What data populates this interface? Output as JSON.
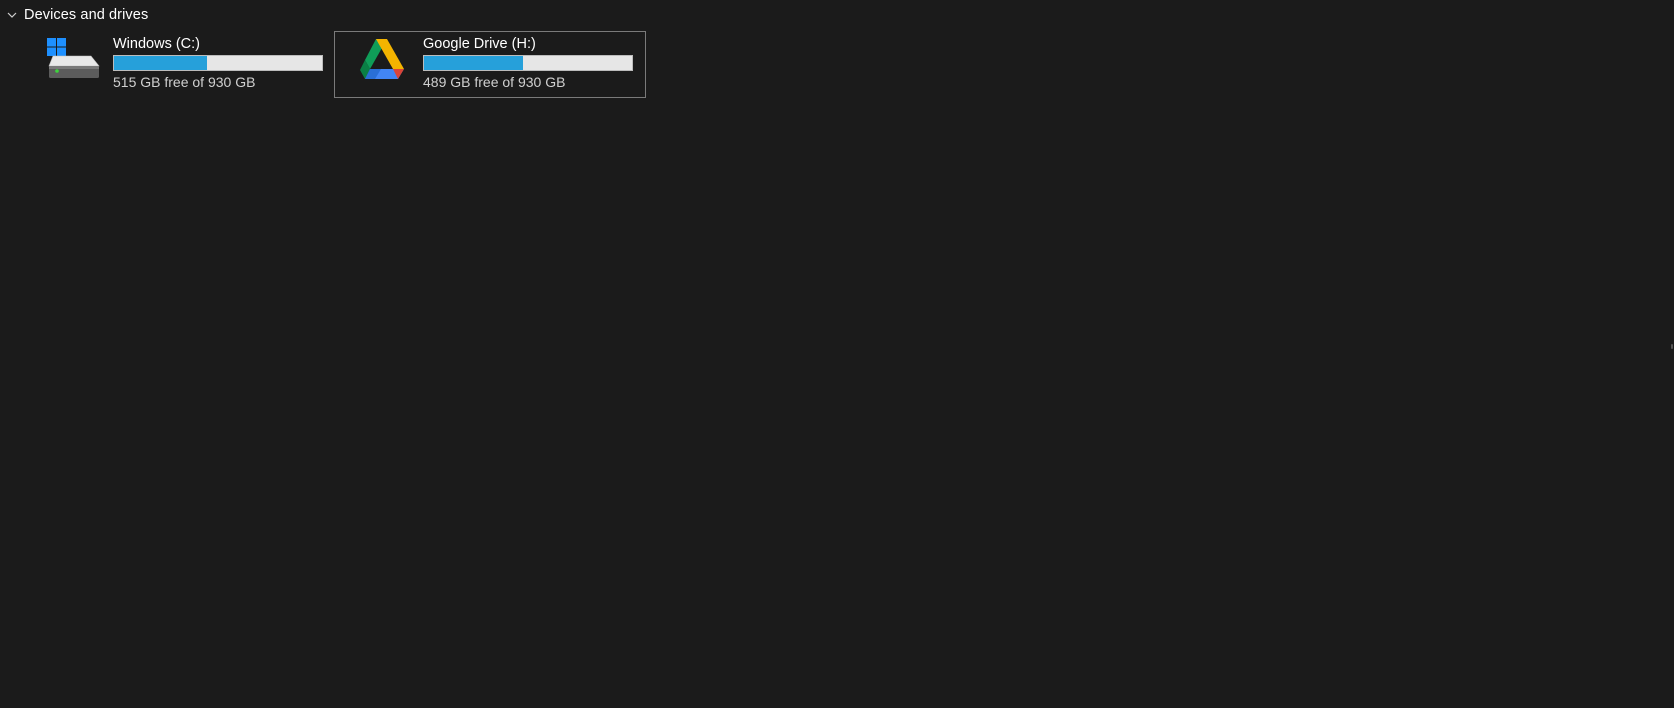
{
  "section": {
    "title": "Devices and drives",
    "expanded": true,
    "icon": "chevron-down-icon"
  },
  "drives": [
    {
      "name": "Windows (C:)",
      "space_text": "515 GB free of 930 GB",
      "used_fraction": 0.446,
      "icon": "windows-hard-drive-icon",
      "selected": false
    },
    {
      "name": "Google Drive (H:)",
      "space_text": "489 GB free of 930 GB",
      "used_fraction": 0.474,
      "icon": "google-drive-icon",
      "selected": true
    }
  ],
  "colors": {
    "background": "#1b1b1b",
    "usage_fill": "#26a0da",
    "usage_track": "#e6e6e6",
    "selection_border": "#7a7a7a",
    "text": "#ffffff"
  }
}
